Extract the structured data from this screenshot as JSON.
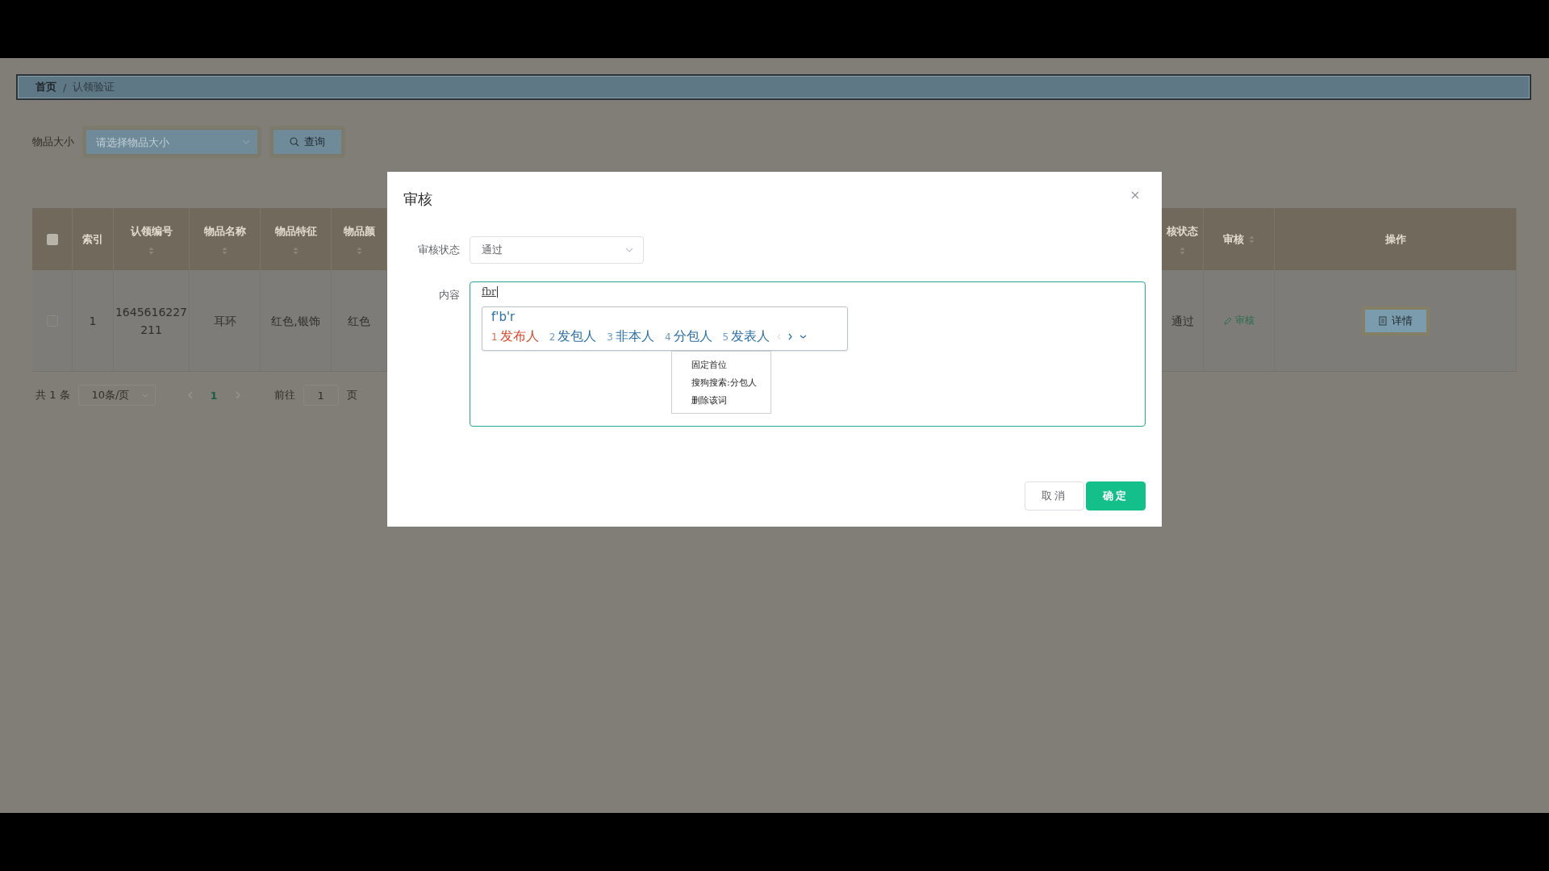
{
  "breadcrumb": [
    {
      "label": "首页",
      "current": false
    },
    {
      "label": "认领验证",
      "current": true
    }
  ],
  "breadcrumb_separator": "/",
  "search": {
    "label": "物品大小",
    "placeholder": "请选择物品大小",
    "button": "查询"
  },
  "table": {
    "columns": [
      {
        "kind": "check",
        "checked": false
      },
      {
        "kind": "text",
        "label": "索引",
        "sortable": false
      },
      {
        "kind": "text",
        "label": "认领编号",
        "sortable": true
      },
      {
        "kind": "text",
        "label": "物品名称",
        "sortable": true
      },
      {
        "kind": "text",
        "label": "物品特征",
        "sortable": true
      },
      {
        "kind": "text",
        "label": "物品颜",
        "sortable": true
      },
      {
        "kind": "gap"
      },
      {
        "kind": "text",
        "label": "核状态",
        "sortable": true
      },
      {
        "kind": "inline",
        "label": "审核",
        "sortable": true
      },
      {
        "kind": "text",
        "label": "操作",
        "sortable": false
      }
    ],
    "rows": [
      {
        "cells": [
          {
            "kind": "check",
            "checked": false
          },
          {
            "kind": "text",
            "text": "1"
          },
          {
            "kind": "text",
            "text": "1645616227211"
          },
          {
            "kind": "text",
            "text": "耳环"
          },
          {
            "kind": "text",
            "text": "红色,银饰"
          },
          {
            "kind": "text",
            "text": "红色"
          },
          {
            "kind": "gap"
          },
          {
            "kind": "text",
            "text": "通过"
          },
          {
            "kind": "link",
            "text": "审核"
          },
          {
            "kind": "button",
            "text": "详情"
          }
        ]
      }
    ]
  },
  "pagination": {
    "total": "共 1 条",
    "page_size": "10条/页",
    "pages": [
      {
        "label": "1",
        "selected": true
      }
    ],
    "goto_label": "前往",
    "goto_value": "1",
    "goto_suffix": "页"
  },
  "dialog": {
    "title": "审核",
    "fields": [
      {
        "kind": "select",
        "label": "审核状态",
        "value": "通过"
      },
      {
        "kind": "textarea",
        "label": "内容",
        "value": "fbr"
      }
    ],
    "buttons": [
      {
        "label": "取消",
        "primary": false
      },
      {
        "label": "确定",
        "primary": true
      }
    ]
  },
  "ime": {
    "composition": "f'b'r",
    "candidates": [
      {
        "number": "1",
        "text": "发布人",
        "selected": true
      },
      {
        "number": "2",
        "text": "发包人",
        "selected": false
      },
      {
        "number": "3",
        "text": "非本人",
        "selected": false
      },
      {
        "number": "4",
        "text": "分包人",
        "selected": false
      },
      {
        "number": "5",
        "text": "发表人",
        "selected": false
      }
    ],
    "menu": [
      "固定首位",
      "搜狗搜索:分包人",
      "删除该词"
    ]
  }
}
